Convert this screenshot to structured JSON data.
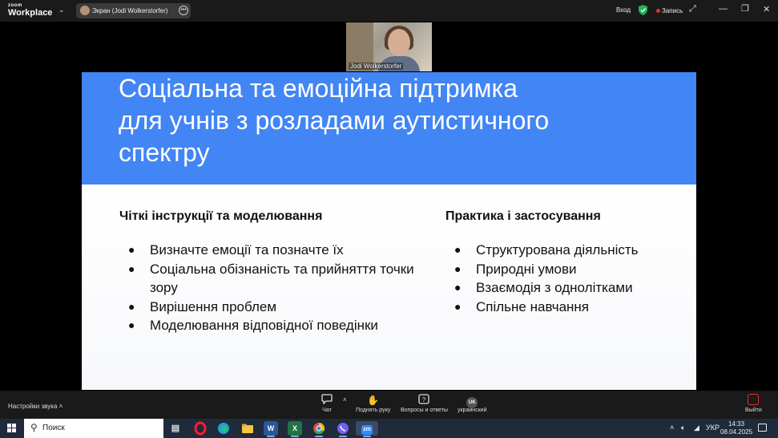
{
  "zoom_bar": {
    "brand_small": "zoom",
    "brand_large": "Workplace",
    "share_label": "Экран (Jodi Wolkerstorfer)",
    "login": "Вход",
    "record": "Запись"
  },
  "video": {
    "participant_name": "Jodi Wolkerstorfer"
  },
  "slide": {
    "title_lines": [
      "Соціальна та емоційна підтримка",
      "для учнів з розладами аутистичного",
      "спектру"
    ],
    "left": {
      "heading": "Чіткі інструкції та моделювання",
      "items": [
        "Визначте емоції та позначте їх",
        "Соціальна обізнаність та прийняття точки зору",
        "Вирішення проблем",
        "Моделювання відповідної поведінки"
      ]
    },
    "right": {
      "heading": "Практика і застосування",
      "items": [
        "Структурована діяльність",
        "Природні умови",
        "Взаємодія з однолітками",
        "Спільне навчання"
      ]
    }
  },
  "toolbar": {
    "audio_settings": "Настройки звука",
    "chat": "Чат",
    "raise_hand": "Поднять руку",
    "qa": "Вопросы и ответы",
    "language_badge": "UK",
    "language": "украинский",
    "leave": "Выйти"
  },
  "taskbar": {
    "search_placeholder": "Поиск",
    "zoom_app_label": "zm",
    "word_label": "W",
    "excel_label": "X",
    "keyboard_lang": "УКР",
    "time": "14:33",
    "date": "08.04.2025"
  },
  "colors": {
    "slide_header": "#4285f4",
    "record_dot": "#e0322f",
    "shield": "#21b35a"
  }
}
